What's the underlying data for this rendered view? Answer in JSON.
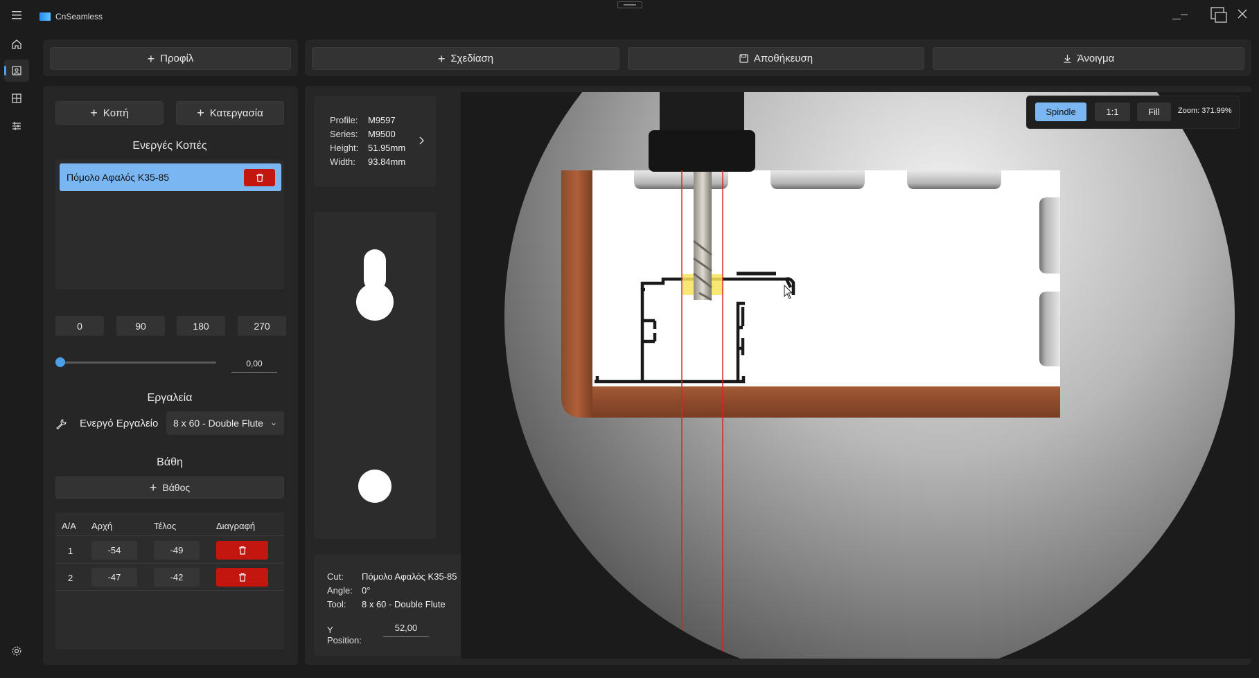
{
  "app": {
    "title": "CnSeamless"
  },
  "colors": {
    "accent": "#7ab7f2",
    "danger": "#c3160f",
    "highlight": "#4a9fe8",
    "bg": "#1c1c1c",
    "panel": "#262626"
  },
  "nav": {
    "items": [
      {
        "icon": "home-icon"
      },
      {
        "icon": "image-icon",
        "active": true
      },
      {
        "icon": "grid-icon"
      },
      {
        "icon": "sliders-icon"
      }
    ],
    "settings_icon": "gear-icon"
  },
  "toolbar": {
    "profile_label": "Προφίλ",
    "design_label": "Σχεδίαση",
    "save_label": "Αποθήκευση",
    "open_label": "Άνοιγμα"
  },
  "left": {
    "cut_label": "Κοπή",
    "processing_label": "Κατεργασία",
    "active_cuts_title": "Ενεργές Κοπές",
    "active_cuts": [
      {
        "name": "Πόμολο Αφαλός K35-85"
      }
    ],
    "angles": [
      "0",
      "90",
      "180",
      "270"
    ],
    "slider_value": "0,00",
    "slider_fraction": 0,
    "tools_title": "Εργαλεία",
    "active_tool_label": "Ενεργό Εργαλείο",
    "active_tool_value": "8 x 60 - Double Flute",
    "depths_title": "Βάθη",
    "add_depth_label": "Βάθος",
    "depth_table": {
      "headers": [
        "Α/Α",
        "Αρχή",
        "Τέλος",
        "Διαγραφή"
      ],
      "rows": [
        {
          "index": "1",
          "start": "-54",
          "end": "-49"
        },
        {
          "index": "2",
          "start": "-47",
          "end": "-42"
        }
      ]
    }
  },
  "profile_info": {
    "profile_key": "Profile:",
    "profile_val": "M9597",
    "series_key": "Series:",
    "series_val": "M9500",
    "height_key": "Height:",
    "height_val": "51.95mm",
    "width_key": "Width:",
    "width_val": "93.84mm"
  },
  "cut_info": {
    "cut_key": "Cut:",
    "cut_val": "Πόμολο Αφαλός K35-85",
    "angle_key": "Angle:",
    "angle_val": "0°",
    "tool_key": "Tool:",
    "tool_val": "8 x 60 - Double Flute",
    "ypos_key": "Y Position:",
    "ypos_val": "52,00"
  },
  "view": {
    "spindle_label": "Spindle",
    "one_to_one_label": "1:1",
    "fill_label": "Fill",
    "zoom_text": "Zoom: 371.99%"
  }
}
